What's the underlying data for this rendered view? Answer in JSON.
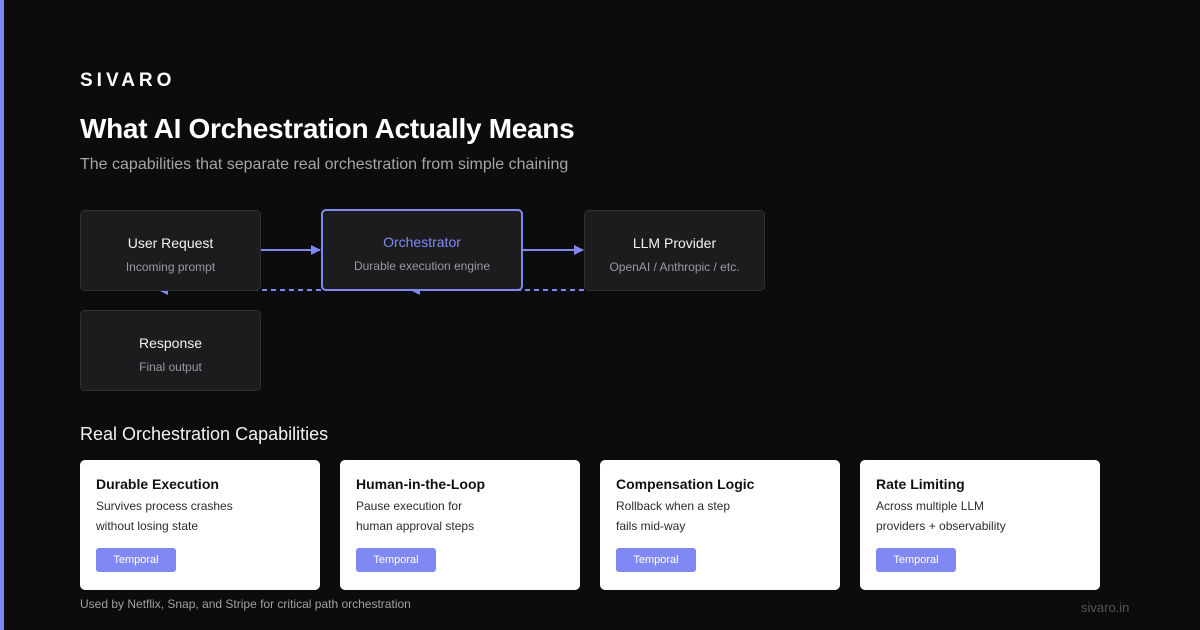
{
  "brand": "SIVARO",
  "header": {
    "title": "What AI Orchestration Actually Means",
    "subtitle": "The capabilities that separate real orchestration from simple chaining"
  },
  "flow": {
    "nodes": [
      {
        "id": "user",
        "title": "User Request",
        "desc": "Incoming prompt"
      },
      {
        "id": "orchestrator",
        "title": "Orchestrator",
        "desc": "Durable execution engine"
      },
      {
        "id": "llm",
        "title": "LLM Provider",
        "desc": "OpenAI / Anthropic / etc."
      },
      {
        "id": "response",
        "title": "Response",
        "desc": "Final output"
      }
    ],
    "edges": [
      {
        "from": "user",
        "to": "orchestrator",
        "style": "solid"
      },
      {
        "from": "orchestrator",
        "to": "llm",
        "style": "solid"
      },
      {
        "from": "llm",
        "to": "orchestrator",
        "style": "dashed"
      },
      {
        "from": "orchestrator",
        "to": "user",
        "style": "dashed"
      }
    ]
  },
  "capabilities": {
    "heading": "Real Orchestration Capabilities",
    "cards": [
      {
        "title": "Durable Execution",
        "line1": "Survives process crashes",
        "line2": "without losing state",
        "badge": "Temporal"
      },
      {
        "title": "Human-in-the-Loop",
        "line1": "Pause execution for",
        "line2": "human approval steps",
        "badge": "Temporal"
      },
      {
        "title": "Compensation Logic",
        "line1": "Rollback when a step",
        "line2": "fails mid-way",
        "badge": "Temporal"
      },
      {
        "title": "Rate Limiting",
        "line1": "Across multiple LLM",
        "line2": "providers + observability",
        "badge": "Temporal"
      }
    ]
  },
  "footer": {
    "note": "Used by Netflix, Snap, and Stripe for critical path orchestration",
    "domain": "sivaro.in"
  },
  "colors": {
    "accent": "#8088f4",
    "background": "#0c0c0d",
    "node_fill": "#1c1c1f",
    "card_fill": "#ffffff"
  }
}
